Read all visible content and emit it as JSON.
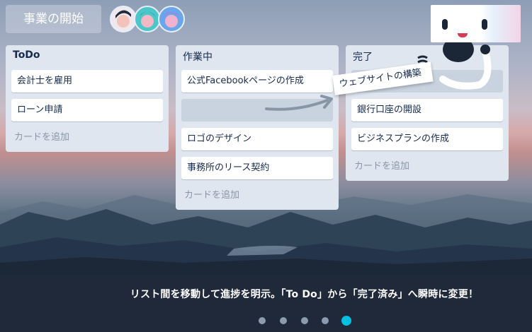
{
  "board": {
    "title": "事業の開始",
    "members": [
      "member-1",
      "member-2",
      "member-3"
    ]
  },
  "lists": [
    {
      "title": "ToDo",
      "cards": [
        "会計士を雇用",
        "ローン申請"
      ],
      "add_card": "カードを追加"
    },
    {
      "title": "作業中",
      "cards": [
        "公式Facebookページの作成",
        "",
        "ロゴのデザイン",
        "事務所のリース契約"
      ],
      "add_card": "カードを追加"
    },
    {
      "title": "完了",
      "cards": [
        "",
        "銀行口座の開設",
        "ビジネスプランの作成"
      ],
      "add_card": "カードを追加"
    }
  ],
  "dragging_card": "ウェブサイトの構築",
  "caption": "リスト間を移動して進捗を明示。「To Do」から「完了済み」へ瞬時に変更！",
  "carousel": {
    "total": 5,
    "active": 5
  },
  "colors": {
    "accent": "#00c2e0",
    "list_bg": "#dfe6ef",
    "bar_bg": "#21293a"
  }
}
